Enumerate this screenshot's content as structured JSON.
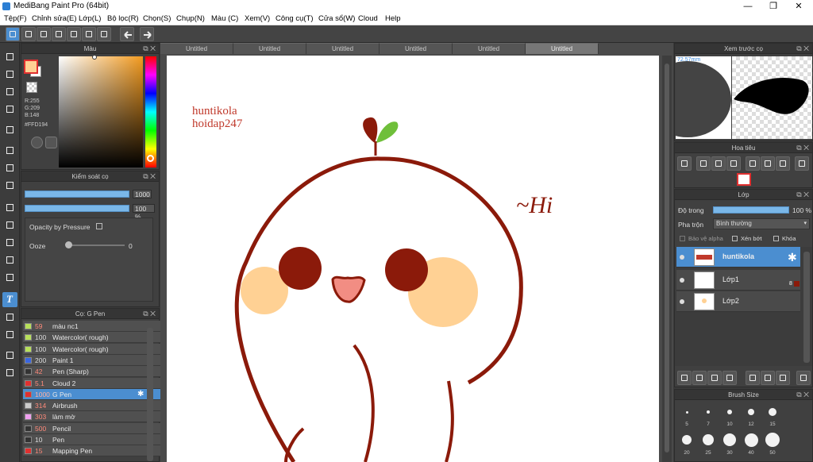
{
  "window": {
    "title": "MediBang Paint Pro (64bit)",
    "minimize": "—",
    "maximize": "❐",
    "close": "✕"
  },
  "menu": [
    "Tệp(F)",
    "Chỉnh sửa(E)",
    "Lớp(L)",
    "Bộ lọc(R)",
    "Chọn(S)",
    "Chụp(N)",
    "Màu (C)",
    "Xem(V)",
    "Công cụ(T)",
    "Cửa sổ(W)",
    "Cloud",
    "Help"
  ],
  "color_panel": {
    "title": "Màu",
    "r": "R:255",
    "g": "G:209",
    "b": "B:148",
    "hex": "#FFD194",
    "primary": "#FFD194"
  },
  "brush_control": {
    "title": "Kiểm soát cọ",
    "size_value": "1000",
    "opacity_value": "100 %",
    "opacity_by_pressure": "Opacity by Pressure",
    "ooze_label": "Ooze",
    "ooze_value": "0",
    "size_fill": 1.0,
    "opacity_fill": 1.0
  },
  "brush_list": {
    "title": "Cọ: G Pen",
    "items": [
      {
        "size": "59",
        "name": "màu nc1",
        "color": "#b8e05a"
      },
      {
        "size": "100",
        "name": "Watercolor( rough)",
        "color": "#b8e05a"
      },
      {
        "size": "100",
        "name": "Watercolor( rough)",
        "color": "#b8e05a"
      },
      {
        "size": "200",
        "name": "Paint 1",
        "color": "#3a66e0"
      },
      {
        "size": "42",
        "name": "Pen (Sharp)",
        "color": "#333333"
      },
      {
        "size": "5.1",
        "name": "Cloud 2",
        "color": "#e03030"
      },
      {
        "size": "1000",
        "name": "G Pen",
        "color": "#e03030"
      },
      {
        "size": "314",
        "name": "Airbrush",
        "color": "#cccccc"
      },
      {
        "size": "303",
        "name": "làm mờ",
        "color": "#f0a0f0"
      },
      {
        "size": "500",
        "name": "Pencil",
        "color": "#333333"
      },
      {
        "size": "10",
        "name": "Pen",
        "color": "#333333"
      },
      {
        "size": "15",
        "name": "Mapping Pen",
        "color": "#e03030"
      }
    ],
    "selected_index": 6
  },
  "tabs": [
    "Untitled",
    "Untitled",
    "Untitled",
    "Untitled",
    "Untitled",
    "Untitled"
  ],
  "canvas_text": {
    "line1": "huntikola",
    "line2": "hoidap247",
    "hi": "~Hi"
  },
  "preview": {
    "title": "Xem trước cọ",
    "size": "72.57mm"
  },
  "navigator": {
    "title": "Hoa tiêu"
  },
  "layers": {
    "title": "Lớp",
    "opacity_label": "Độ trong",
    "opacity_value": "100 %",
    "opacity_fill": 1.0,
    "blend_label": "Pha trộn",
    "blend_value": "Bình thường",
    "protect_alpha": "Bảo vệ alpha",
    "clipping": "Xén bớt",
    "lock": "Khóa",
    "items": [
      {
        "name": "huntikola",
        "selected": true
      },
      {
        "name": "Lớp1",
        "selected": false,
        "badge": "8"
      },
      {
        "name": "Lớp2",
        "selected": false
      }
    ]
  },
  "brush_size": {
    "title": "Brush Size",
    "row1": [
      "5",
      "7",
      "10",
      "12",
      "15"
    ],
    "row2": [
      "20",
      "25",
      "30",
      "40",
      "50"
    ]
  }
}
